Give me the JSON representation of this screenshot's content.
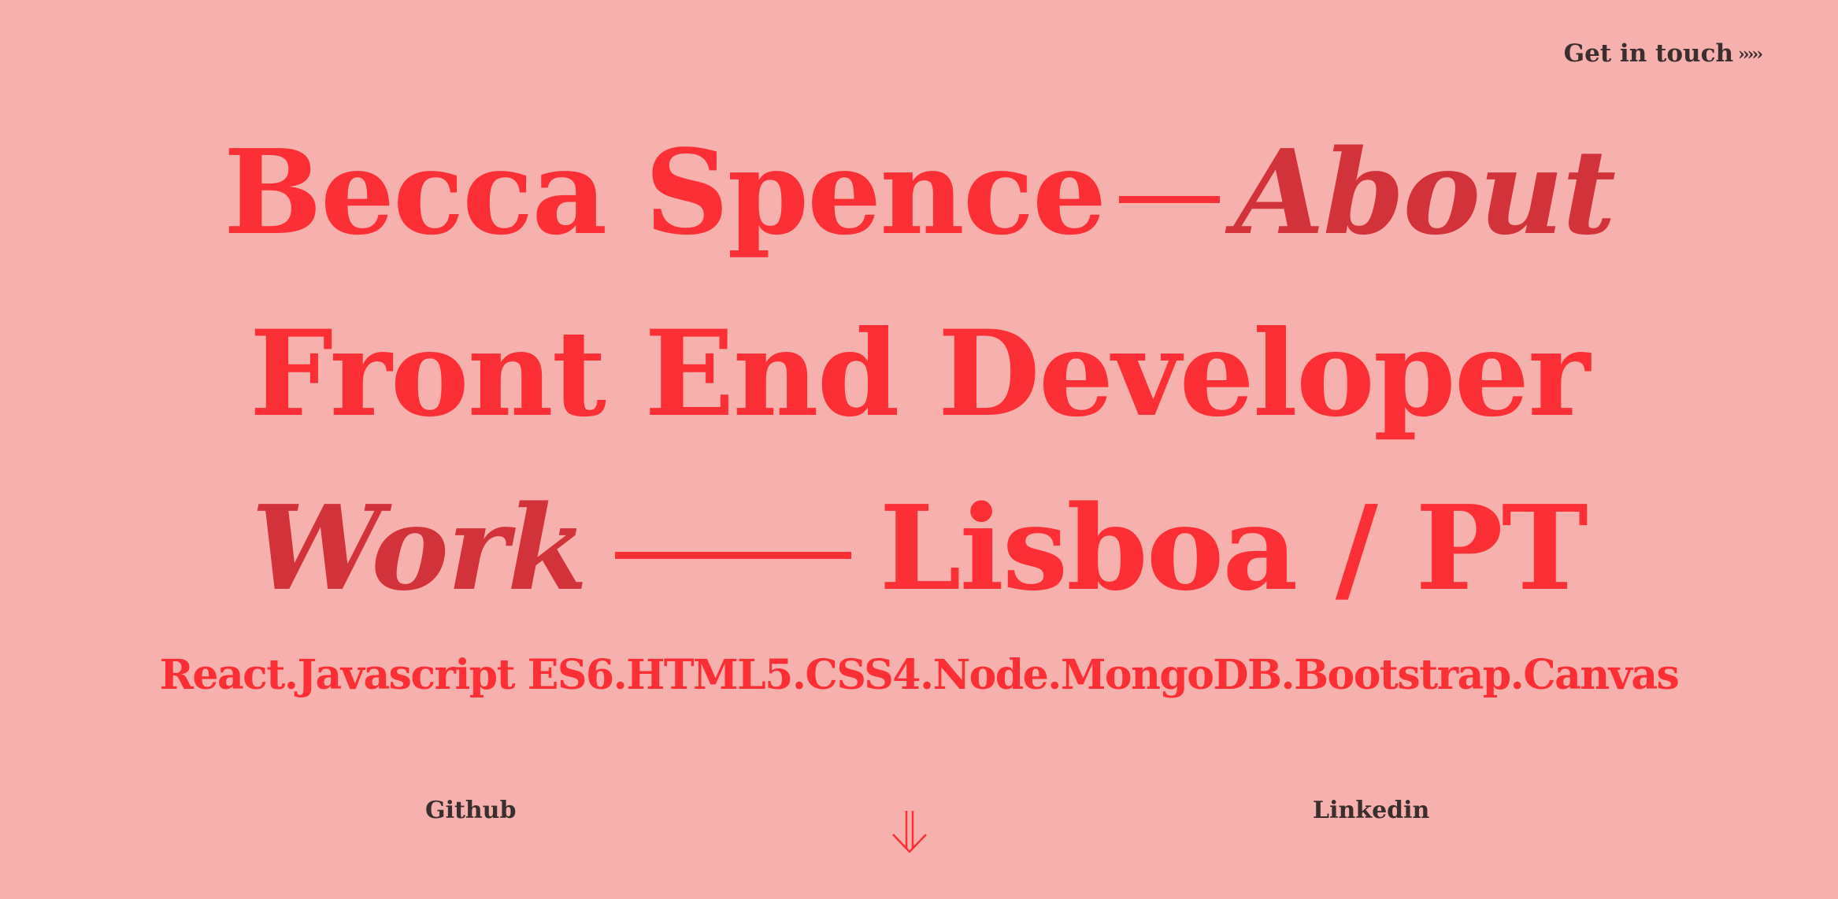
{
  "header": {
    "contact_label": "Get in touch",
    "contact_arrows": "›››››"
  },
  "hero": {
    "line1": {
      "name": "Becca Spence",
      "italic": "About"
    },
    "line2": {
      "text": "Front End Developer"
    },
    "line3": {
      "italic": "Work",
      "location": "Lisboa / PT"
    }
  },
  "skills": "React.Javascript ES6.HTML5.CSS4.Node.MongoDB.Bootstrap.Canvas",
  "footer": {
    "github_label": "Github",
    "linkedin_label": "Linkedin",
    "scroll_icon": "double-down-arrow-icon"
  },
  "colors": {
    "background": "#f6b0ad",
    "accent": "#fd2f36",
    "accent_italic": "#d2323a",
    "link_text": "#3b2e2e"
  }
}
